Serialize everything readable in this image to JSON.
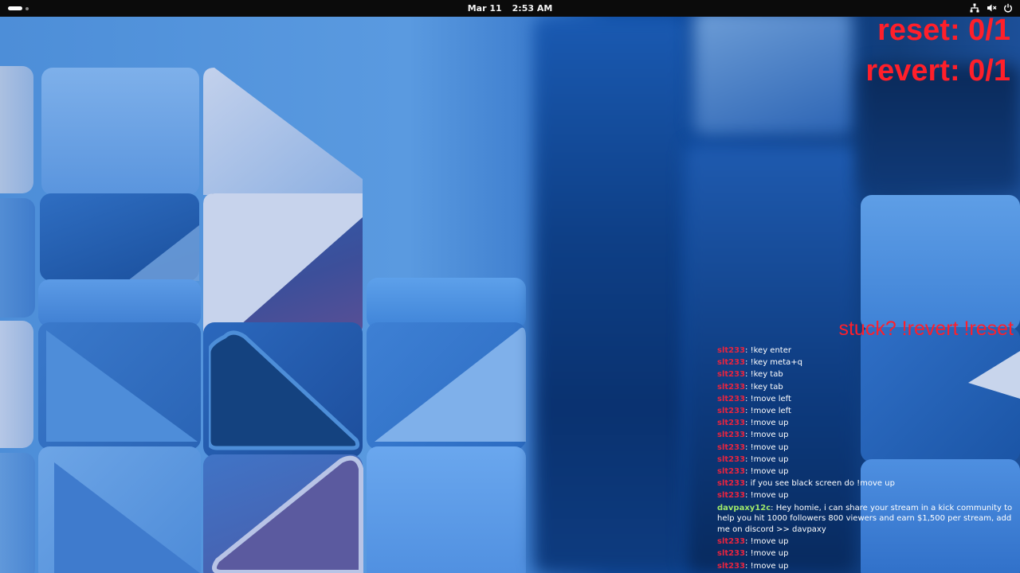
{
  "topbar": {
    "date": "Mar 11",
    "time": "2:53 AM",
    "icons": [
      "activities-icon",
      "network-icon",
      "volume-muted-icon",
      "power-icon"
    ]
  },
  "overlay": {
    "reset": "reset: 0/1",
    "revert": "revert: 0/1",
    "hint": "stuck? !revert !reset",
    "color": "#ff1f2a"
  },
  "chat": {
    "messages": [
      {
        "user": "slt233",
        "text": "!key enter",
        "color": "#e8243f"
      },
      {
        "user": "slt233",
        "text": "!key meta+q",
        "color": "#e8243f"
      },
      {
        "user": "slt233",
        "text": "!key tab",
        "color": "#e8243f"
      },
      {
        "user": "slt233",
        "text": "!key tab",
        "color": "#e8243f"
      },
      {
        "user": "slt233",
        "text": "!move left",
        "color": "#e8243f"
      },
      {
        "user": "slt233",
        "text": "!move left",
        "color": "#e8243f"
      },
      {
        "user": "slt233",
        "text": "!move up",
        "color": "#e8243f"
      },
      {
        "user": "slt233",
        "text": "!move up",
        "color": "#e8243f"
      },
      {
        "user": "slt233",
        "text": "!move up",
        "color": "#e8243f"
      },
      {
        "user": "slt233",
        "text": "!move up",
        "color": "#e8243f"
      },
      {
        "user": "slt233",
        "text": "!move up",
        "color": "#e8243f"
      },
      {
        "user": "slt233",
        "text": "if you see black screen do !move up",
        "color": "#e8243f"
      },
      {
        "user": "slt233",
        "text": "!move up",
        "color": "#e8243f"
      },
      {
        "user": "davpaxy12c",
        "text": "Hey homie, i can share your stream in a kick community to help you hit 1000 followers 800 viewers and earn $1,500 per stream, add me on discord >> davpaxy",
        "color": "#9ee86a"
      },
      {
        "user": "slt233",
        "text": "!move up",
        "color": "#e8243f"
      },
      {
        "user": "slt233",
        "text": "!move up",
        "color": "#e8243f"
      },
      {
        "user": "slt233",
        "text": "!move up",
        "color": "#e8243f"
      }
    ]
  }
}
